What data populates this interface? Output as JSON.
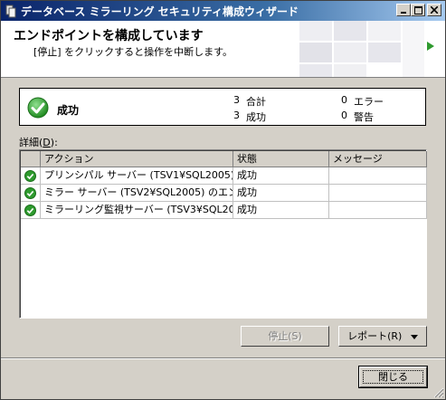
{
  "window": {
    "title": "データベース ミラーリング セキュリティ構成ウィザード",
    "controls": {
      "minimize": "minimize-icon",
      "maximize": "maximize-icon",
      "close": "close-icon"
    }
  },
  "header": {
    "title": "エンドポイントを構成しています",
    "subtitle": "[停止] をクリックすると操作を中断します。"
  },
  "summary": {
    "status": "成功",
    "total_count": "3",
    "total_label": "合計",
    "success_count": "3",
    "success_label": "成功",
    "error_count": "0",
    "error_label": "エラー",
    "warning_count": "0",
    "warning_label": "警告"
  },
  "details": {
    "label": "詳細",
    "accelerator": "D",
    "columns": [
      "アクション",
      "状態",
      "メッセージ"
    ],
    "rows": [
      {
        "icon": "success-icon",
        "action": "プリンシパル サーバー (TSV1¥SQL2005) ...",
        "status": "成功",
        "message": ""
      },
      {
        "icon": "success-icon",
        "action": "ミラー サーバー (TSV2¥SQL2005) のエン...",
        "status": "成功",
        "message": ""
      },
      {
        "icon": "success-icon",
        "action": "ミラーリング監視サーバー (TSV3¥SQL200...",
        "status": "成功",
        "message": ""
      }
    ]
  },
  "buttons": {
    "stop": "停止(S)",
    "report": "レポート(R)",
    "close": "閉じる"
  },
  "colors": {
    "success": "#2e9a2e",
    "title_bar": "#0a246a",
    "header_arrow": "#2e9a2e"
  }
}
